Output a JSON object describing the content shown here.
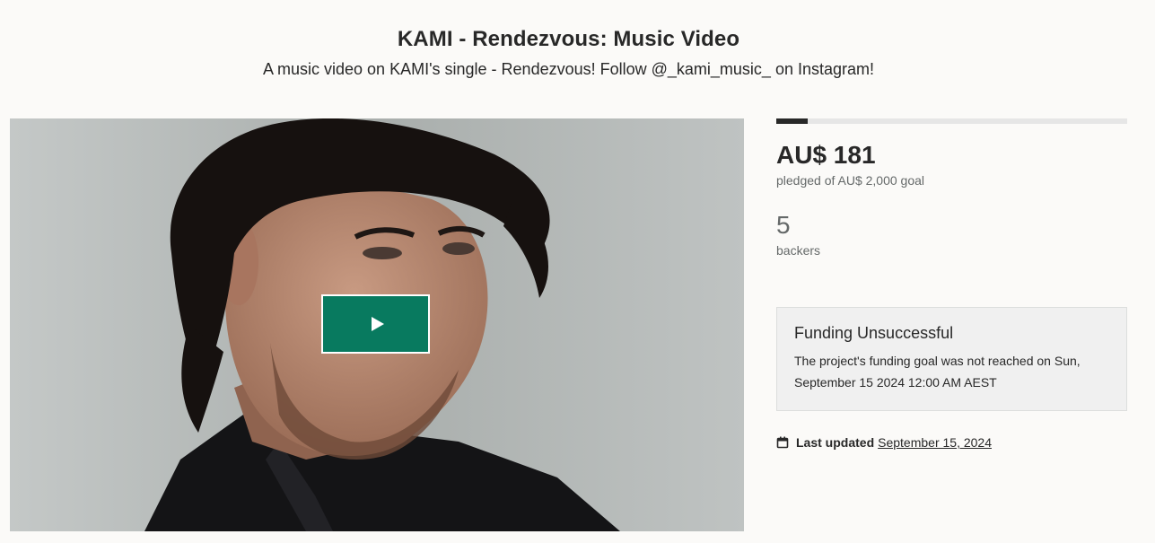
{
  "project": {
    "title": "KAMI - Rendezvous: Music Video",
    "blurb": "A music video on KAMI's single - Rendezvous! Follow @_kami_music_ on Instagram!"
  },
  "media": {
    "play_icon": "play-icon",
    "play_button_color": "#087a5f"
  },
  "funding": {
    "progress_fraction": 0.09,
    "pledged": "AU$ 181",
    "pledged_label": "pledged of AU$ 2,000 goal",
    "backers": "5",
    "backers_label": "backers"
  },
  "status": {
    "title": "Funding Unsuccessful",
    "message": "The project's funding goal was not reached on Sun, September 15 2024 12:00 AM AEST"
  },
  "updated": {
    "icon": "calendar-icon",
    "label": "Last updated",
    "date": "September 15, 2024"
  }
}
